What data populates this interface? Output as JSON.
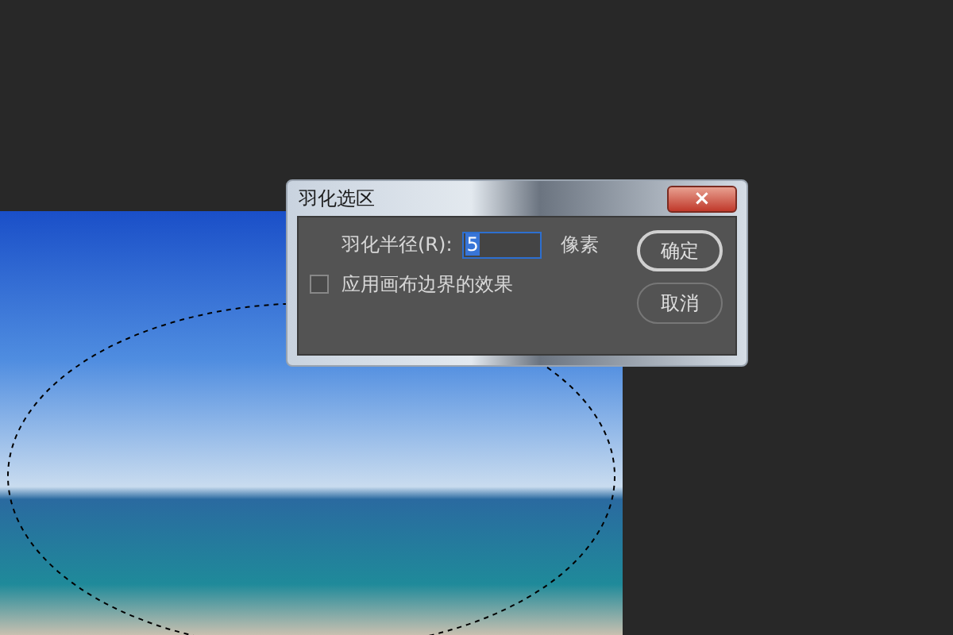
{
  "dialog": {
    "title": "羽化选区",
    "close_label": "×"
  },
  "feather": {
    "label": "羽化半径(R):",
    "value": "5",
    "unit": "像素"
  },
  "edge_option": {
    "label": "应用画布边界的效果",
    "checked": false
  },
  "buttons": [
    {
      "label": "确定",
      "kind": "default"
    },
    {
      "label": "取消",
      "kind": "normal"
    }
  ]
}
